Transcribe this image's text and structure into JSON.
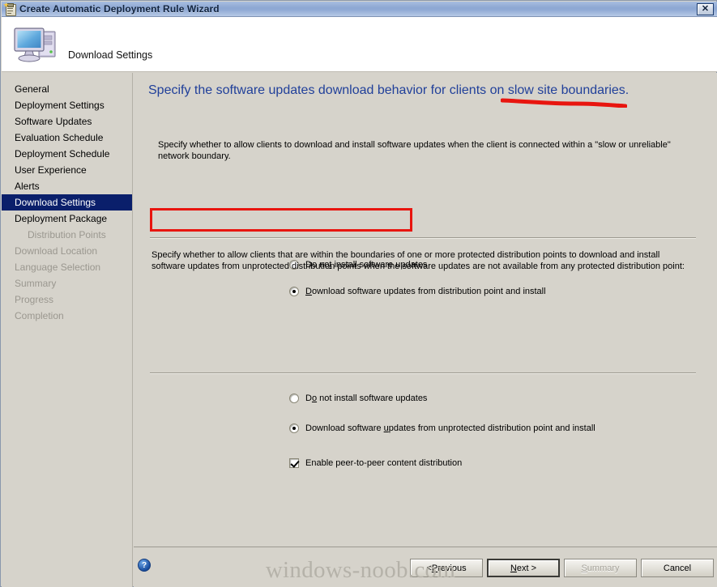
{
  "window": {
    "title": "Create Automatic Deployment Rule Wizard",
    "close_label": "✕",
    "titlebar_icon": "wizard-clipboard-icon"
  },
  "header": {
    "title": "Download Settings",
    "icon": "computer-monitor-icon"
  },
  "sidebar": {
    "items": [
      {
        "label": "General",
        "state": "normal",
        "indent": false
      },
      {
        "label": "Deployment Settings",
        "state": "normal",
        "indent": false
      },
      {
        "label": "Software Updates",
        "state": "normal",
        "indent": false
      },
      {
        "label": "Evaluation Schedule",
        "state": "normal",
        "indent": false
      },
      {
        "label": "Deployment Schedule",
        "state": "normal",
        "indent": false
      },
      {
        "label": "User Experience",
        "state": "normal",
        "indent": false
      },
      {
        "label": "Alerts",
        "state": "normal",
        "indent": false
      },
      {
        "label": "Download Settings",
        "state": "active",
        "indent": false
      },
      {
        "label": "Deployment Package",
        "state": "normal",
        "indent": false
      },
      {
        "label": "Distribution Points",
        "state": "dim",
        "indent": true
      },
      {
        "label": "Download Location",
        "state": "dim",
        "indent": false
      },
      {
        "label": "Language Selection",
        "state": "dim",
        "indent": false
      },
      {
        "label": "Summary",
        "state": "dim",
        "indent": false
      },
      {
        "label": "Progress",
        "state": "dim",
        "indent": false
      },
      {
        "label": "Completion",
        "state": "dim",
        "indent": false
      }
    ]
  },
  "main": {
    "heading": "Specify the software updates download behavior for clients on slow site boundaries.",
    "paragraph_1": "Specify whether to allow clients to download and install software updates when the client is connected within a \"slow or unreliable\" network boundary.",
    "paragraph_2": "Specify whether to allow clients that are within the boundaries of one or more protected distribution points to download and install software updates from unprotected distribution points when the software updates are not available from any protected distribution point:",
    "slow_boundary_options": [
      {
        "label": "Do not install software updates",
        "accel": "t",
        "checked": false
      },
      {
        "label": "Download software updates from distribution point and install",
        "accel": "D",
        "checked": true
      }
    ],
    "unprotected_options": [
      {
        "label": "Do not install software updates",
        "accel": "o",
        "checked": false
      },
      {
        "label": "Download software updates from unprotected distribution point and install",
        "accel": "u",
        "checked": true
      }
    ],
    "peer_checkbox": {
      "label": "Enable peer-to-peer content distribution",
      "checked": true
    }
  },
  "footer": {
    "help_glyph": "?",
    "buttons": [
      {
        "label": "< Previous",
        "accel": "P",
        "state": "normal"
      },
      {
        "label": "Next >",
        "accel": "N",
        "state": "default"
      },
      {
        "label": "Summary",
        "accel": "S",
        "state": "disabled"
      },
      {
        "label": "Cancel",
        "accel": "",
        "state": "normal"
      }
    ]
  },
  "watermark": {
    "text": "windows-noob.com"
  },
  "annotations": {
    "highlight_color": "#e8150f",
    "underline_target": "slow site boundaries.",
    "box_target": "Download software updates from distribution point and install"
  }
}
